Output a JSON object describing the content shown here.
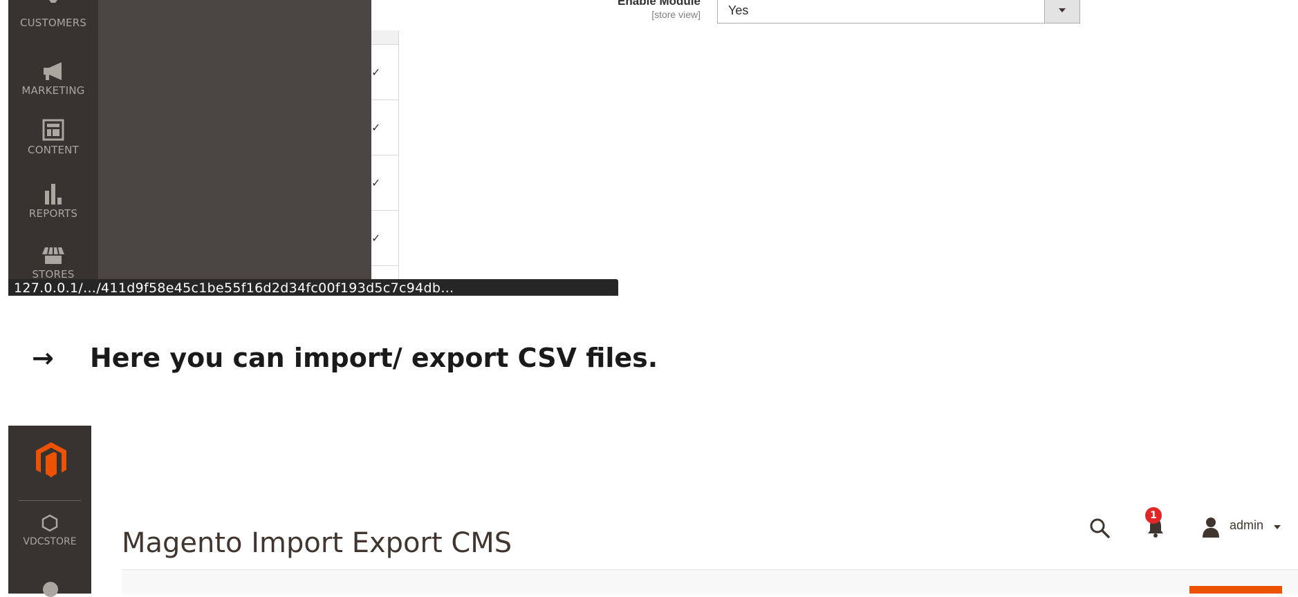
{
  "top_screenshot": {
    "menu": [
      {
        "label": "CUSTOMERS",
        "icon": "customers-icon"
      },
      {
        "label": "MARKETING",
        "icon": "megaphone-icon"
      },
      {
        "label": "CONTENT",
        "icon": "content-layout-icon"
      },
      {
        "label": "REPORTS",
        "icon": "bar-chart-icon"
      },
      {
        "label": "STORES",
        "icon": "store-icon"
      }
    ],
    "grid_checks": [
      "✓",
      "✓",
      "✓",
      "✓"
    ],
    "field": {
      "label": "Enable Module",
      "scope": "[store view]",
      "value": "Yes"
    },
    "status_url": "127.0.0.1/…/411d9f58e45c1be55f16d2d34fc00f193d5c7c94db…"
  },
  "instruction": {
    "arrow": "→",
    "text": "Here you can import/ export CSV files."
  },
  "bottom_screenshot": {
    "rail_item": {
      "label": "VDCSTORE",
      "icon": "hexagon-icon"
    },
    "page_title": "Magento Import Export CMS",
    "notifications_count": "1",
    "user_name": "admin"
  },
  "colors": {
    "rail": "#373330",
    "submenu": "#4a4542",
    "magento_orange": "#eb5202",
    "badge_red": "#e22626"
  }
}
